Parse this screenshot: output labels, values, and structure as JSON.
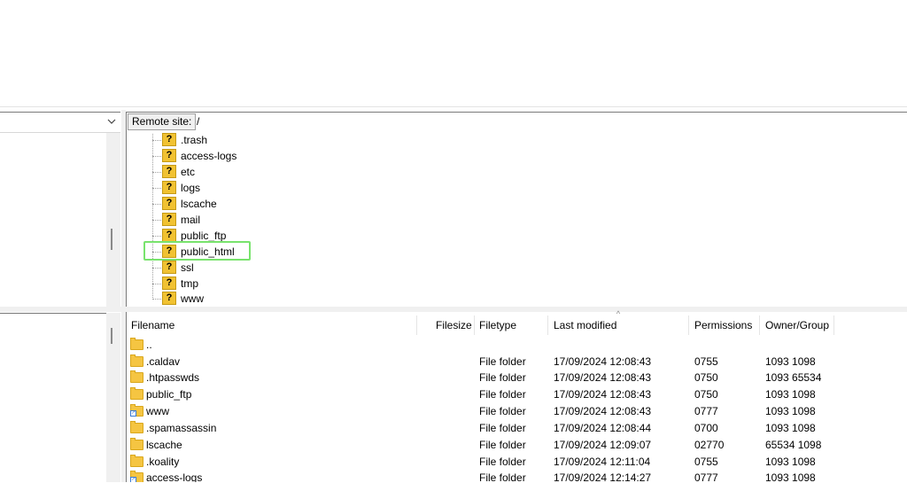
{
  "remote": {
    "label": "Remote site:",
    "path": "/"
  },
  "tree": {
    "items": [
      {
        "label": ".trash"
      },
      {
        "label": "access-logs"
      },
      {
        "label": "etc"
      },
      {
        "label": "logs"
      },
      {
        "label": "lscache"
      },
      {
        "label": "mail"
      },
      {
        "label": "public_ftp"
      },
      {
        "label": "public_html",
        "highlighted": true
      },
      {
        "label": "ssl"
      },
      {
        "label": "tmp"
      },
      {
        "label": "www"
      }
    ],
    "highlight_color": "#79e36d",
    "icon": "unknown-folder-icon"
  },
  "file_list": {
    "columns": {
      "filename": "Filename",
      "filesize": "Filesize",
      "filetype": "Filetype",
      "last_modified": "Last modified",
      "permissions": "Permissions",
      "owner_group": "Owner/Group"
    },
    "sorted_by": "last_modified",
    "rows": [
      {
        "name": "..",
        "size": "",
        "type": "",
        "modified": "",
        "perms": "",
        "owner": "",
        "icon": "folder-icon"
      },
      {
        "name": ".caldav",
        "size": "",
        "type": "File folder",
        "modified": "17/09/2024 12:08:43",
        "perms": "0755",
        "owner": "1093 1098",
        "icon": "folder-icon"
      },
      {
        "name": ".htpasswds",
        "size": "",
        "type": "File folder",
        "modified": "17/09/2024 12:08:43",
        "perms": "0750",
        "owner": "1093 65534",
        "icon": "folder-icon"
      },
      {
        "name": "public_ftp",
        "size": "",
        "type": "File folder",
        "modified": "17/09/2024 12:08:43",
        "perms": "0750",
        "owner": "1093 1098",
        "icon": "folder-icon"
      },
      {
        "name": "www",
        "size": "",
        "type": "File folder",
        "modified": "17/09/2024 12:08:43",
        "perms": "0777",
        "owner": "1093 1098",
        "icon": "folder-link-icon"
      },
      {
        "name": ".spamassassin",
        "size": "",
        "type": "File folder",
        "modified": "17/09/2024 12:08:44",
        "perms": "0700",
        "owner": "1093 1098",
        "icon": "folder-icon"
      },
      {
        "name": "lscache",
        "size": "",
        "type": "File folder",
        "modified": "17/09/2024 12:09:07",
        "perms": "02770",
        "owner": "65534 1098",
        "icon": "folder-icon"
      },
      {
        "name": ".koality",
        "size": "",
        "type": "File folder",
        "modified": "17/09/2024 12:11:04",
        "perms": "0755",
        "owner": "1093 1098",
        "icon": "folder-icon"
      },
      {
        "name": "access-logs",
        "size": "",
        "type": "File folder",
        "modified": "17/09/2024 12:14:27",
        "perms": "0777",
        "owner": "1093 1098",
        "icon": "folder-link-icon"
      }
    ]
  }
}
